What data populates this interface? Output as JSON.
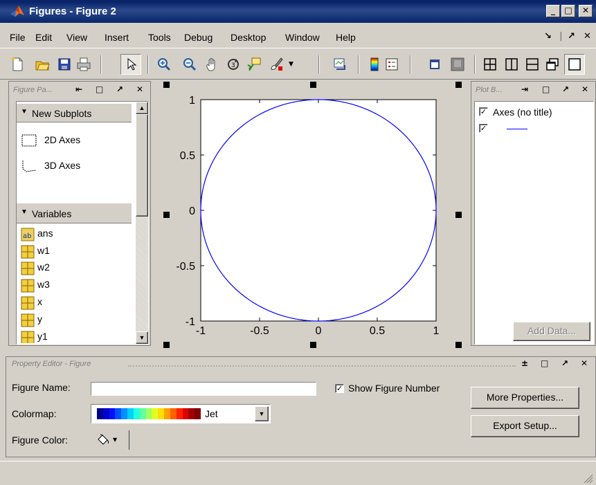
{
  "window": {
    "title": "Figures - Figure 2"
  },
  "menu": {
    "items": [
      "File",
      "Edit",
      "View",
      "Insert",
      "Tools",
      "Debug",
      "Desktop",
      "Window",
      "Help"
    ]
  },
  "figure_palette": {
    "header": "Figure Pa...",
    "new_subplots_label": "New Subplots",
    "axes_2d_label": "2D Axes",
    "axes_3d_label": "3D Axes",
    "variables_label": "Variables",
    "variables": [
      "ans",
      "w1",
      "w2",
      "w3",
      "x",
      "y",
      "y1"
    ]
  },
  "plot_browser": {
    "header": "Plot B...",
    "axes_label": "Axes (no title)",
    "line_color": "#0000ff",
    "add_data_label": "Add Data..."
  },
  "chart_data": {
    "type": "line",
    "series": [
      {
        "x_expr": "cos(t)",
        "y_expr": "sin(t)",
        "color": "#0000ff"
      }
    ],
    "xlim": [
      -1,
      1
    ],
    "ylim": [
      -1,
      1
    ],
    "xticks": [
      "-1",
      "-0.5",
      "0",
      "0.5",
      "1"
    ],
    "yticks": [
      "1",
      "0.5",
      "0",
      "-0.5",
      "-1"
    ],
    "grid": false
  },
  "property_editor": {
    "header": "Property Editor - Figure",
    "figure_name_label": "Figure Name:",
    "figure_name_value": "",
    "show_figure_number_label": "Show Figure Number",
    "show_figure_number_checked": true,
    "colormap_label": "Colormap:",
    "colormap_value": "Jet",
    "figure_color_label": "Figure Color:",
    "more_properties_label": "More Properties...",
    "export_setup_label": "Export Setup..."
  }
}
